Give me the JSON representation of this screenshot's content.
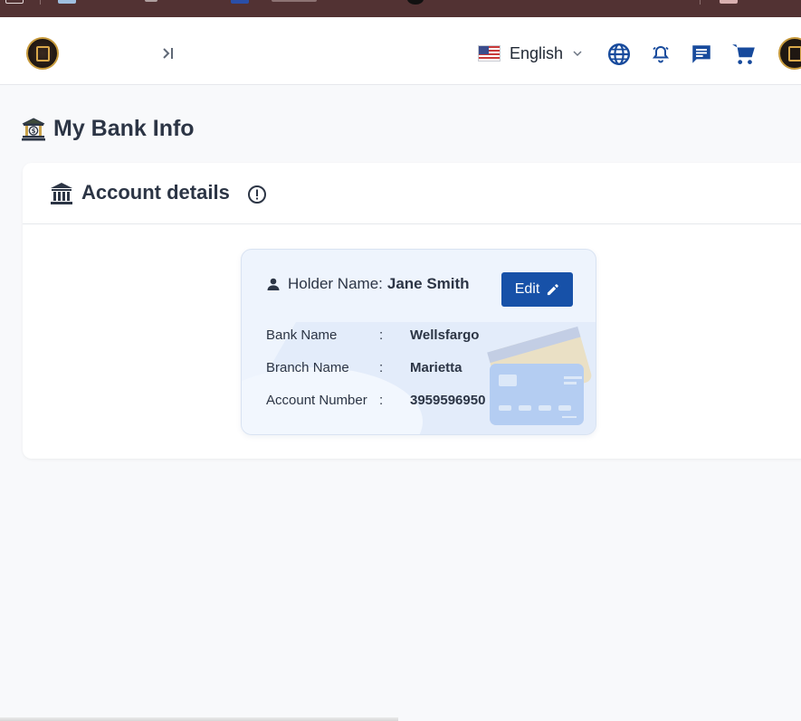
{
  "header": {
    "language": "English",
    "icons": [
      "logo",
      "collapse-sidebar-icon",
      "us-flag-icon",
      "chevron-down-icon",
      "globe-icon",
      "bell-icon",
      "chat-icon",
      "cart-icon",
      "avatar"
    ]
  },
  "page": {
    "title": "My Bank Info"
  },
  "panel": {
    "title": "Account details"
  },
  "card": {
    "holder_label": "Holder Name:",
    "holder_name": "Jane Smith",
    "edit_label": "Edit",
    "separator": ":",
    "rows": [
      {
        "label": "Bank Name",
        "value": "Wellsfargo"
      },
      {
        "label": "Branch Name",
        "value": "Marietta"
      },
      {
        "label": "Account Number",
        "value": "3959596950"
      }
    ]
  },
  "colors": {
    "brand_blue": "#1751a8",
    "icon_blue": "#174a9c",
    "bookmark_bar": "#523233",
    "text_dark": "#2c3545"
  }
}
